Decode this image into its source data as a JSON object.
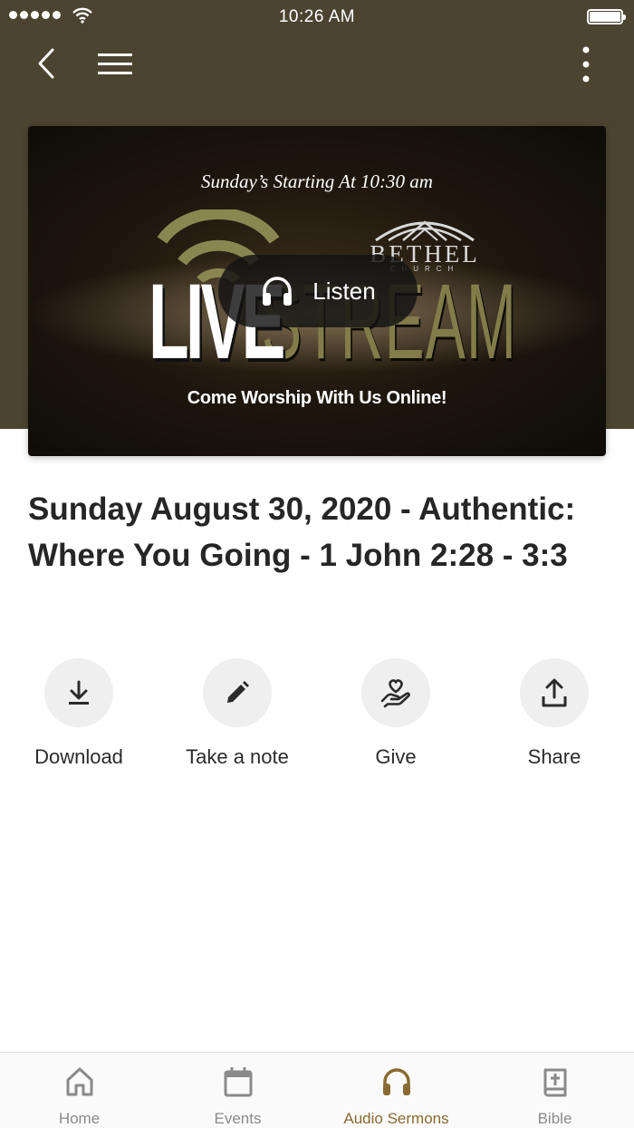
{
  "status_bar": {
    "time": "10:26 AM",
    "signal_icon": "signal-dots-icon",
    "wifi_icon": "wifi-icon",
    "battery_icon": "battery-full-icon"
  },
  "nav": {
    "back_icon": "chevron-left-icon",
    "menu_icon": "hamburger-menu-icon",
    "more_icon": "more-vertical-icon",
    "header_color": "#4b4431"
  },
  "media": {
    "top_text": "Sunday’s Starting At 10:30 am",
    "live_text": "LIVE",
    "stream_text": "STREAM",
    "church_name": "BETHEL",
    "church_word": "CHURCH",
    "bottom_text": "Come Worship With Us Online!",
    "listen_label": "Listen",
    "listen_icon": "headphones-icon"
  },
  "sermon": {
    "title": "Sunday August 30, 2020 - Authentic: Where You Going - 1 John 2:28 - 3:3"
  },
  "actions": [
    {
      "label": "Download",
      "icon": "download-icon"
    },
    {
      "label": "Take a note",
      "icon": "pencil-icon"
    },
    {
      "label": "Give",
      "icon": "give-heart-hand-icon"
    },
    {
      "label": "Share",
      "icon": "share-upload-icon"
    }
  ],
  "tabs": [
    {
      "label": "Home",
      "icon": "home-icon",
      "active": false
    },
    {
      "label": "Events",
      "icon": "calendar-icon",
      "active": false
    },
    {
      "label": "Audio Sermons",
      "icon": "headphones-icon",
      "active": true
    },
    {
      "label": "Bible",
      "icon": "bible-icon",
      "active": false
    }
  ],
  "colors": {
    "accent": "#8a6a32",
    "inactive": "#8a8a8a"
  }
}
